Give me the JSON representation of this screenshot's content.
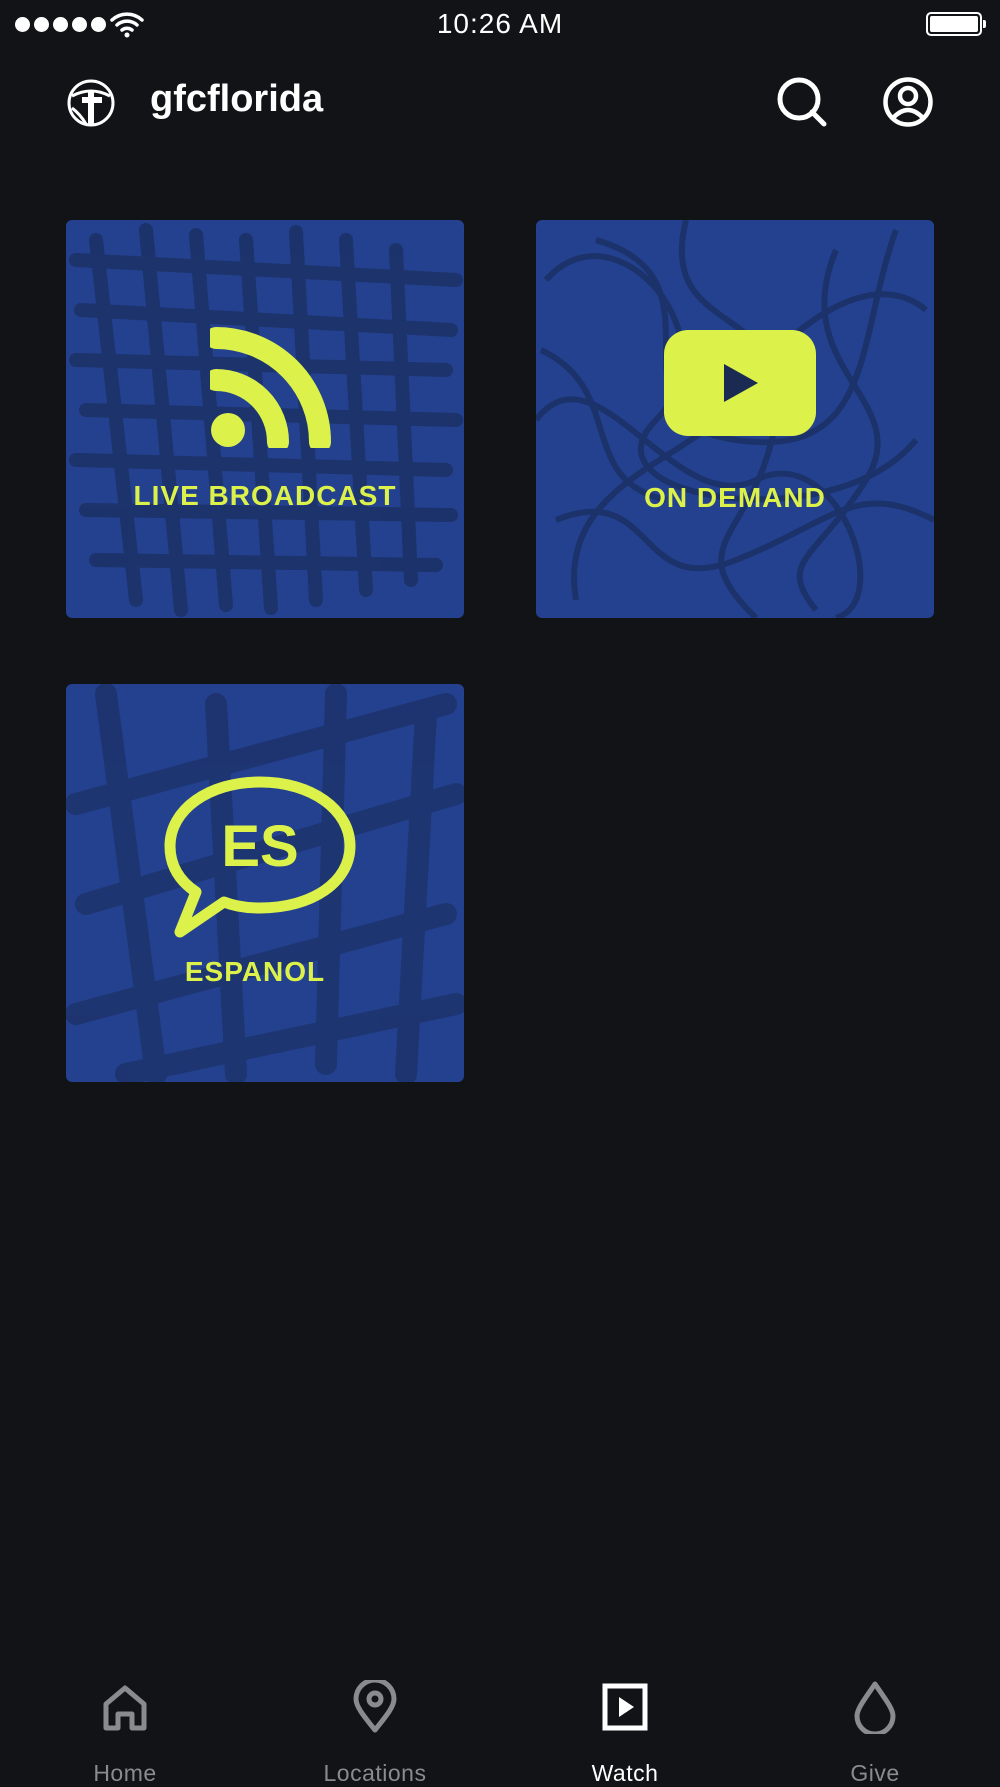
{
  "status_bar": {
    "time": "10:26 AM",
    "signal_bars": 5,
    "battery": 1.0
  },
  "header": {
    "app_name": "gfcflorida",
    "logo_icon": "globe-cross-icon",
    "search_icon": "search-icon",
    "account_icon": "account-icon"
  },
  "tiles": [
    {
      "label": "LIVE BROADCAST",
      "icon": "rss-broadcast-icon"
    },
    {
      "label": "ON DEMAND",
      "icon": "youtube-play-icon"
    },
    {
      "label": "ESPANOL",
      "icon": "es-speech-bubble-icon",
      "badge": "ES"
    }
  ],
  "tabs": [
    {
      "label": "Home",
      "icon": "home-icon",
      "active": false
    },
    {
      "label": "Locations",
      "icon": "location-pin-icon",
      "active": false
    },
    {
      "label": "Watch",
      "icon": "play-square-icon",
      "active": true
    },
    {
      "label": "Give",
      "icon": "drop-icon",
      "active": false
    }
  ],
  "colors": {
    "background": "#121316",
    "tile": "#24418f",
    "accent": "#dcf24a",
    "inactive": "#8a8b8e"
  }
}
